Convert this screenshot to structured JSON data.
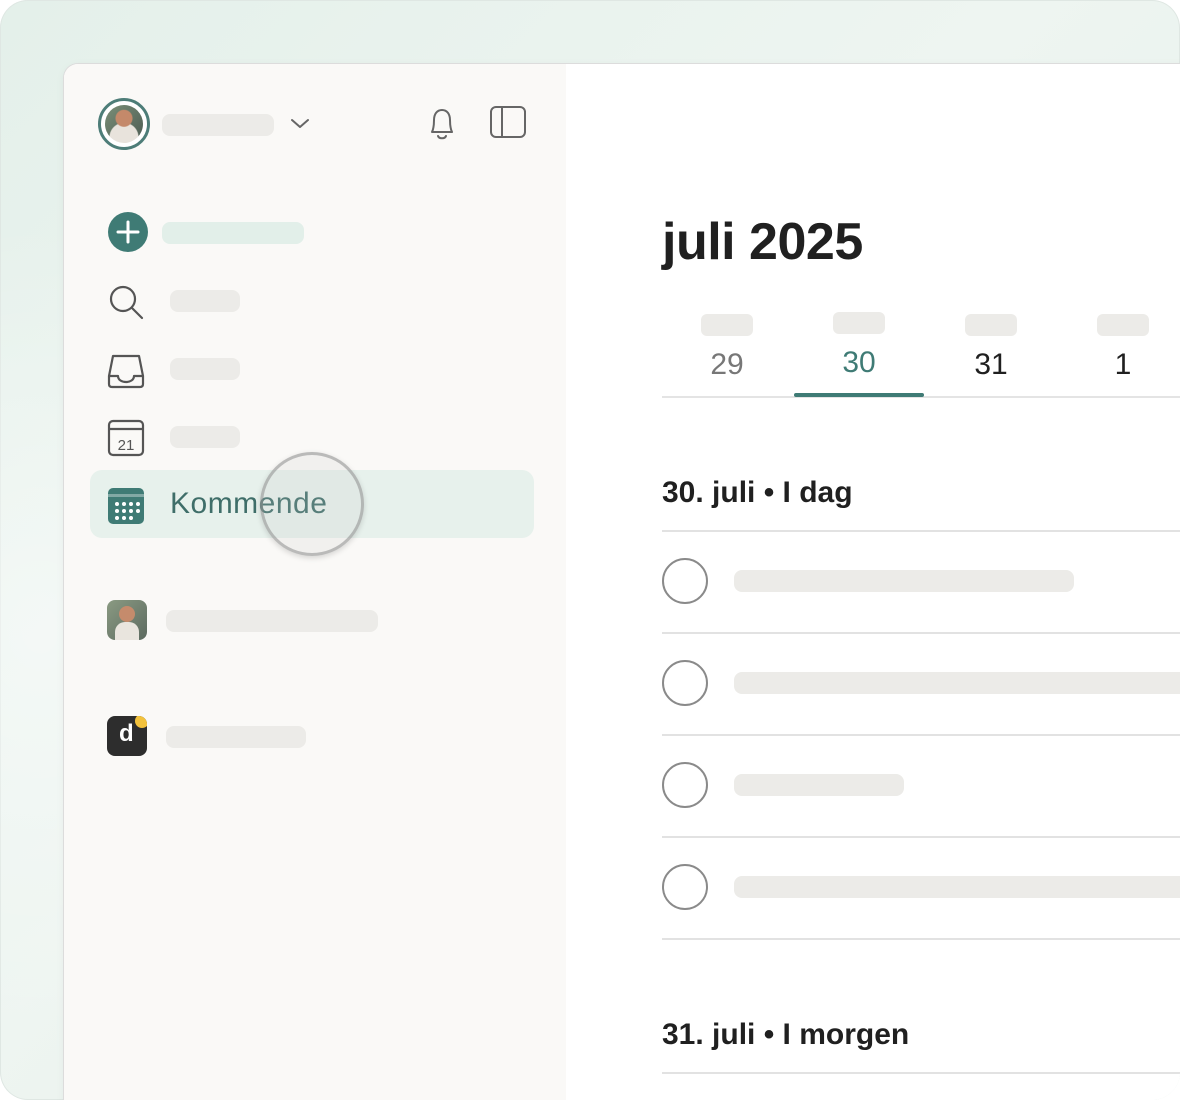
{
  "sidebar": {
    "nav": [
      {
        "id": "add-task",
        "icon": "plus-circle-icon"
      },
      {
        "id": "search",
        "icon": "search-icon"
      },
      {
        "id": "inbox",
        "icon": "inbox-icon"
      },
      {
        "id": "today",
        "icon": "calendar-today-icon",
        "icon_text": "21"
      },
      {
        "id": "upcoming",
        "icon": "calendar-grid-icon",
        "label": "Kommende",
        "active": true
      }
    ]
  },
  "main": {
    "month_title": "juli 2025",
    "days": [
      {
        "num": "29",
        "state": "past"
      },
      {
        "num": "30",
        "state": "today"
      },
      {
        "num": "31",
        "state": "future"
      },
      {
        "num": "1",
        "state": "future"
      }
    ],
    "sections": [
      {
        "heading": "30. juli • I dag"
      },
      {
        "heading": "31. juli • I morgen"
      }
    ]
  },
  "colors": {
    "accent": "#3f7b75",
    "active_bg": "#e7f1ec",
    "sidebar_bg": "#faf9f7",
    "skeleton": "#ecebe8"
  }
}
